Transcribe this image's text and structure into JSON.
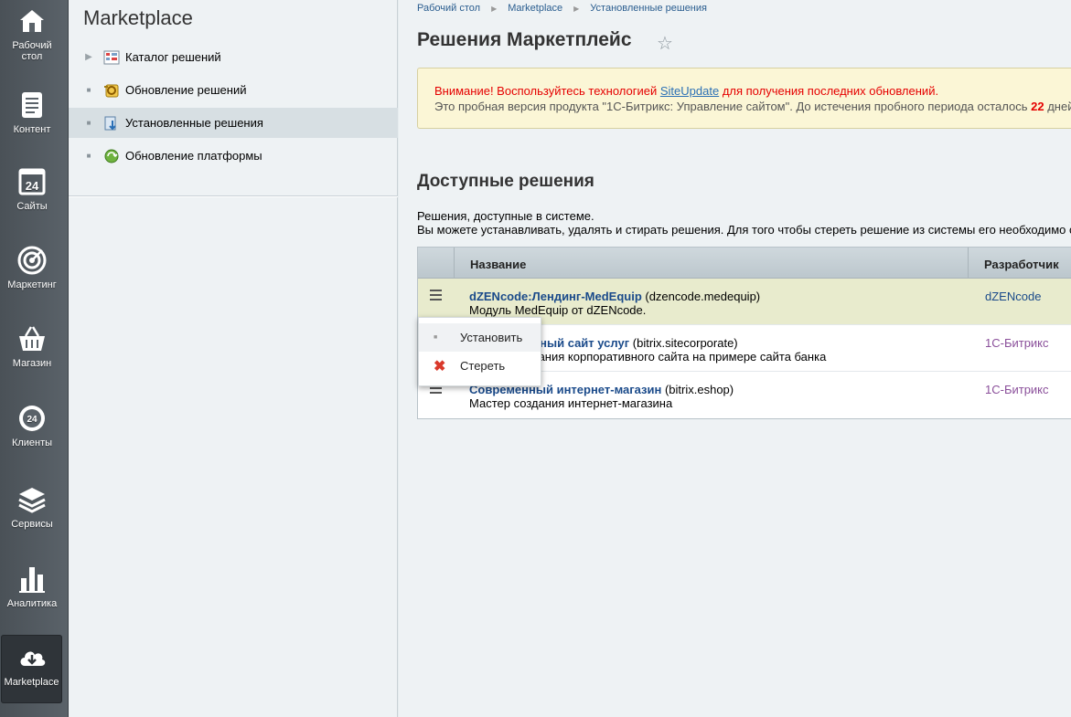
{
  "rail": {
    "items": [
      {
        "label": "Рабочий стол",
        "icon": "home-icon"
      },
      {
        "label": "Контент",
        "icon": "document-icon"
      },
      {
        "label": "Сайты",
        "icon": "calendar-24-icon"
      },
      {
        "label": "Маркетинг",
        "icon": "target-icon"
      },
      {
        "label": "Магазин",
        "icon": "basket-icon"
      },
      {
        "label": "Клиенты",
        "icon": "cloud-24-icon"
      },
      {
        "label": "Сервисы",
        "icon": "layers-icon"
      },
      {
        "label": "Аналитика",
        "icon": "bar-chart-icon"
      },
      {
        "label": "Marketplace",
        "icon": "cloud-download-icon"
      }
    ]
  },
  "menu": {
    "title": "Marketplace",
    "items": [
      {
        "label": "Каталог решений"
      },
      {
        "label": "Обновление решений"
      },
      {
        "label": "Установленные решения"
      },
      {
        "label": "Обновление платформы"
      }
    ]
  },
  "breadcrumb": [
    "Рабочий стол",
    "Marketplace",
    "Установленные решения"
  ],
  "page": {
    "title": "Решения Маркетплейс"
  },
  "notice": {
    "line1_prefix": "Внимание! Воспользуйтесь технологией ",
    "line1_link": "SiteUpdate",
    "line1_suffix": " для получения последних обновлений.",
    "line2_prefix": "Это пробная версия продукта \"1С-Битрикс: Управление сайтом\". До истечения пробного периода осталось ",
    "line2_days": "22",
    "line2_suffix": " дней."
  },
  "section": {
    "title": "Доступные решения",
    "desc1": "Решения, доступные в системе.",
    "desc2": "Вы можете устанавливать, удалять и стирать решения. Для того чтобы стереть решение из системы его необходимо сначала удалить."
  },
  "grid": {
    "col_name": "Название",
    "col_dev": "Разработчик",
    "rows": [
      {
        "name": "dZENcode:Лендинг-MedEquip",
        "code": " (dzencode.medequip)",
        "desc": "Модуль MedEquip от dZENcode.",
        "dev": "dZENcode"
      },
      {
        "name": "Корпоративный сайт услуг",
        "code": " (bitrix.sitecorporate)",
        "desc": "Мастер создания корпоративного сайта на примере сайта банка",
        "dev": "1С-Битрикс"
      },
      {
        "name": "Современный интернет-магазин",
        "code": " (bitrix.eshop)",
        "desc": "Мастер создания интернет-магазина",
        "dev": "1С-Битрикс"
      }
    ]
  },
  "popup": {
    "install": "Установить",
    "erase": "Стереть"
  },
  "colors": {
    "rail": "#4f565c",
    "link": "#1a4a8a",
    "warning": "#e50000",
    "notice_bg": "#fbf6d6",
    "row_highlight": "#e8ebcd"
  }
}
